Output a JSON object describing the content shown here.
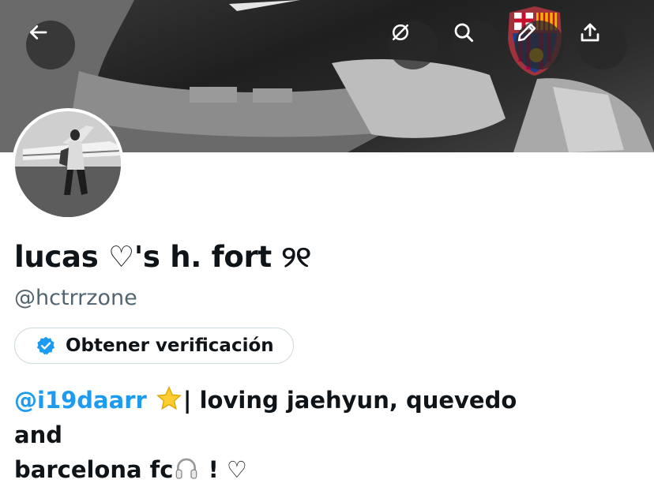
{
  "profile": {
    "display_name": "lucas ♡'s h. fort ୨୧",
    "handle": "@hctrrzone"
  },
  "actions": {
    "back": "back-arrow-icon",
    "hide": "slashed-circle-icon",
    "search": "search-icon",
    "edit": "pencil-icon",
    "share": "share-upload-icon"
  },
  "verification": {
    "label": "Obtener verificación",
    "badge_color": "#1d9bf0"
  },
  "bio": {
    "mention": "@i19daarr",
    "text_1": "| loving jaehyun, quevedo and",
    "text_2": "barcelona fc",
    "text_3": " ! ♡"
  },
  "colors": {
    "link": "#1d9bf0",
    "text": "#0f1419",
    "secondary": "#536471"
  }
}
